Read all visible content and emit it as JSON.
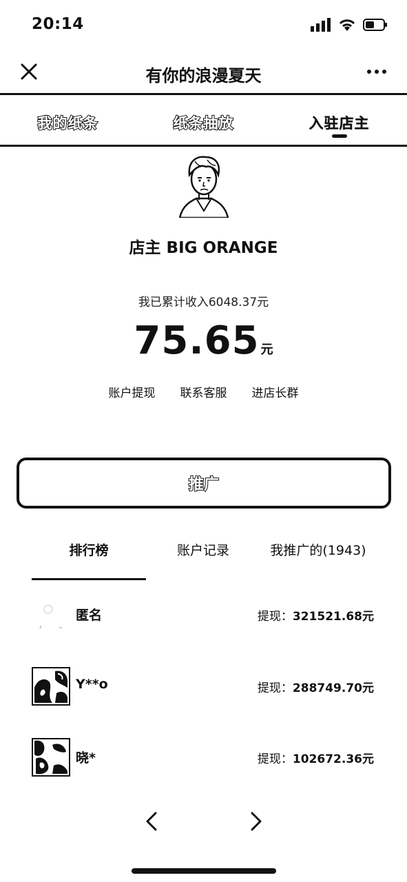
{
  "status_bar": {
    "time": "20:14",
    "icons": [
      "signal-icon",
      "wifi-icon",
      "battery-icon"
    ]
  },
  "nav": {
    "title": "有你的浪漫夏天",
    "close_icon": "close-icon",
    "more_icon": "more-icon"
  },
  "top_tabs": [
    {
      "label": "我的纸条",
      "active": false
    },
    {
      "label": "纸条抽放",
      "active": false
    },
    {
      "label": "入驻店主",
      "active": true
    }
  ],
  "profile": {
    "shop_name": "店主 BIG ORANGE",
    "income_text": "我已累计收入6048.37元",
    "balance": "75.65",
    "balance_unit": "元"
  },
  "actions": [
    {
      "label": "账户提现"
    },
    {
      "label": "联系客服"
    },
    {
      "label": "进店长群"
    }
  ],
  "promote_button": {
    "label": "推广"
  },
  "rank_tabs": [
    {
      "label": "排行榜",
      "active": true
    },
    {
      "label": "账户记录",
      "active": false
    },
    {
      "label": "我推广的(1943)",
      "active": false
    }
  ],
  "rank_list": [
    {
      "name": "匿名",
      "amount_label": "提现：",
      "amount": "321521.68元"
    },
    {
      "name": "Y**o",
      "amount_label": "提现：",
      "amount": "288749.70元"
    },
    {
      "name": "晓*",
      "amount_label": "提现：",
      "amount": "102672.36元"
    }
  ],
  "pager": {
    "prev_icon": "chevron-left-icon",
    "next_icon": "chevron-right-icon"
  }
}
